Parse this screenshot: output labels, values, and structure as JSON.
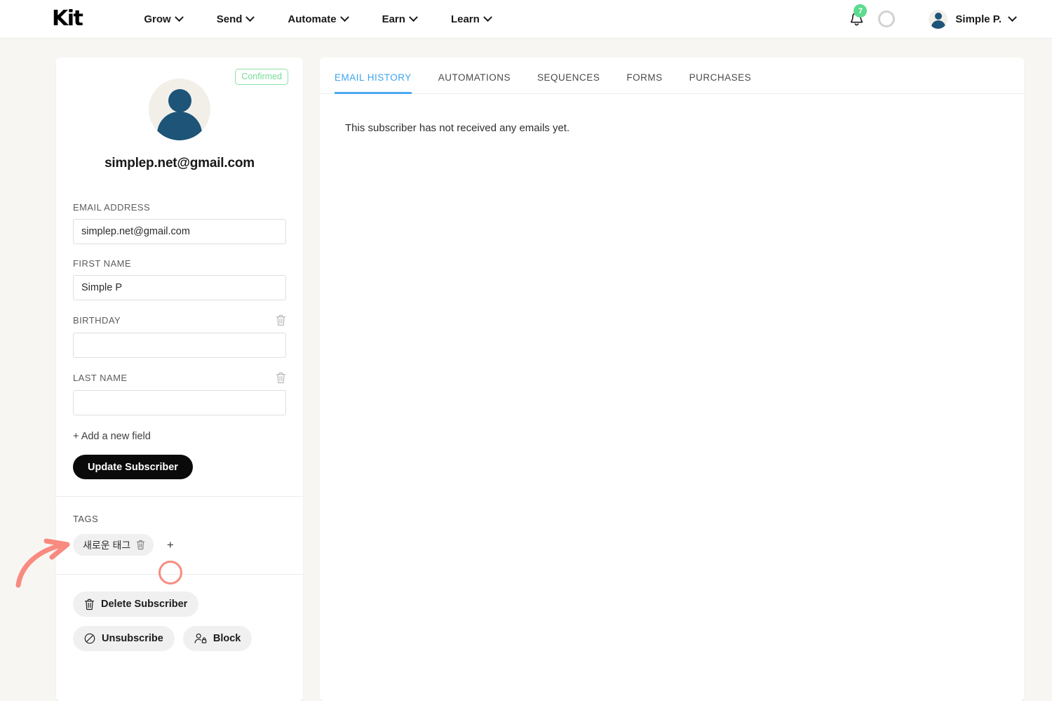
{
  "nav": {
    "logo": "Kit",
    "items": [
      {
        "label": "Grow"
      },
      {
        "label": "Send"
      },
      {
        "label": "Automate"
      },
      {
        "label": "Earn"
      },
      {
        "label": "Learn"
      }
    ],
    "notification_count": "7",
    "user_name": "Simple P.",
    "icons": {
      "bell": "bell-icon",
      "ring": "progress-ring-icon",
      "user_avatar": "avatar-icon",
      "chevron": "chevron-down-icon"
    }
  },
  "subscriber": {
    "status_badge": "Confirmed",
    "email_heading": "simplep.net@gmail.com",
    "fields": [
      {
        "label": "EMAIL ADDRESS",
        "value": "simplep.net@gmail.com",
        "deletable": false
      },
      {
        "label": "FIRST NAME",
        "value": "Simple P",
        "deletable": false
      },
      {
        "label": "BIRTHDAY",
        "value": "",
        "deletable": true
      },
      {
        "label": "LAST NAME",
        "value": "",
        "deletable": true
      }
    ],
    "add_field_label": "+ Add a new field",
    "update_button": "Update Subscriber",
    "tags_title": "TAGS",
    "tags": [
      {
        "label": "새로운 태그"
      }
    ],
    "add_tag_label": "+",
    "actions": [
      {
        "label": "Delete Subscriber",
        "icon": "trash-icon"
      },
      {
        "label": "Unsubscribe",
        "icon": "ban-icon"
      },
      {
        "label": "Block",
        "icon": "user-block-icon"
      }
    ]
  },
  "content": {
    "tabs": [
      {
        "label": "EMAIL HISTORY",
        "active": true
      },
      {
        "label": "AUTOMATIONS",
        "active": false
      },
      {
        "label": "SEQUENCES",
        "active": false
      },
      {
        "label": "FORMS",
        "active": false
      },
      {
        "label": "PURCHASES",
        "active": false
      }
    ],
    "empty_message": "This subscriber has not received any emails yet."
  },
  "annotations": {
    "arrow_color": "#f98a7f",
    "circle_color": "#f98a7f",
    "arrow_target": "tags-title",
    "circle_target": "add-tag-button"
  },
  "colors": {
    "page_background": "#f7f6f3",
    "accent_blue": "#4aabf2",
    "badge_green": "#5ddb8e",
    "confirmed_green": "#77dd96",
    "annotation_salmon": "#f98a7f",
    "avatar_navy": "#1d5478"
  }
}
